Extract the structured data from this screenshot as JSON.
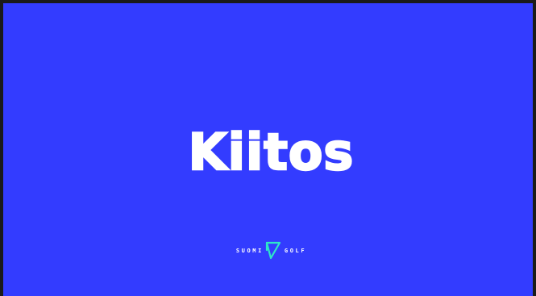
{
  "slide": {
    "title": "Kiitos",
    "background_color": "#333cff",
    "text_color": "#ffffff"
  },
  "logo": {
    "text": "SUOMIGOLF",
    "left_word": "SUOMI",
    "right_word": "GOLF",
    "mark_icon": "flag-arrow-icon",
    "mark_color": "#2ee6c8"
  }
}
